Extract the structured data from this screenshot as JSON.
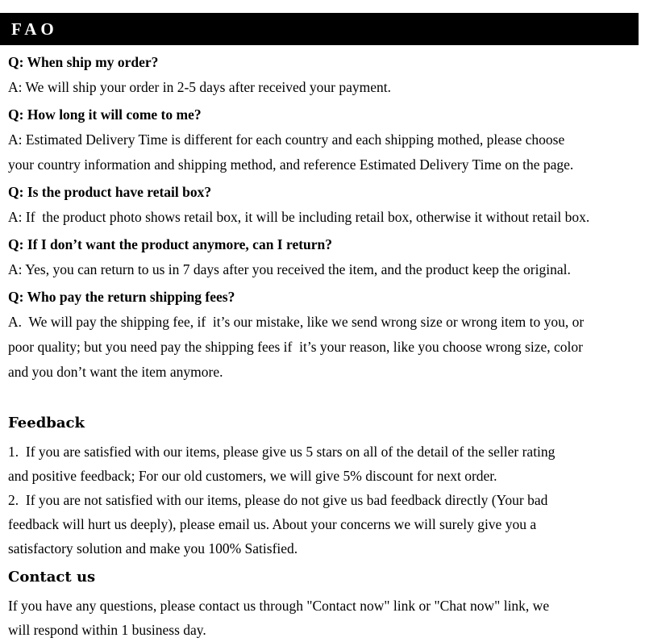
{
  "header": {
    "title": "FAO",
    "background_color": "#000000",
    "text_color": "#ffffff"
  },
  "faq": {
    "items": [
      {
        "question": "Q: When ship my order?",
        "answer_lines": [
          "A: We will ship your order in 2-5 days after received your payment."
        ]
      },
      {
        "question": "Q: How long it will come to me?",
        "answer_lines": [
          "A: Estimated Delivery Time is different for each country and each shipping mothed, please choose",
          "your country information and shipping method, and reference Estimated Delivery Time on the page."
        ]
      },
      {
        "question": "Q: Is the product have retail box?",
        "answer_lines": [
          "A: If  the product photo shows retail box, it will be including retail box, otherwise it without retail box."
        ]
      },
      {
        "question": "Q: If I don’t want the product anymore, can I return?",
        "answer_lines": [
          "A: Yes, you can return to us in 7 days after you received the item, and the product keep the original."
        ]
      },
      {
        "question": "Q: Who pay the return shipping fees?",
        "answer_lines": [
          "A.  We will pay the shipping fee, if  it’s our mistake, like we send wrong size or wrong item to you, or",
          "poor quality; but you need pay the shipping fees if  it’s your reason, like you choose wrong size, color",
          "and you don’t want the item anymore."
        ]
      }
    ]
  },
  "feedback": {
    "heading": "Feedback",
    "lines": [
      "1.  If you are satisfied with our items, please give us 5 stars on all of the detail of the seller rating",
      "and positive feedback; For our old customers, we will give 5% discount for next order.",
      "2.  If you are not satisfied with our items, please do not give us bad feedback directly (Your bad",
      "feedback will hurt us deeply), please email us. About your concerns we will surely give you a",
      "satisfactory solution and make you 100% Satisfied."
    ]
  },
  "contact": {
    "heading": "Contact us",
    "lines": [
      "If you have any questions, please contact us through \"Contact now\" link or \"Chat now\" link, we",
      "will respond within 1 business day."
    ]
  }
}
